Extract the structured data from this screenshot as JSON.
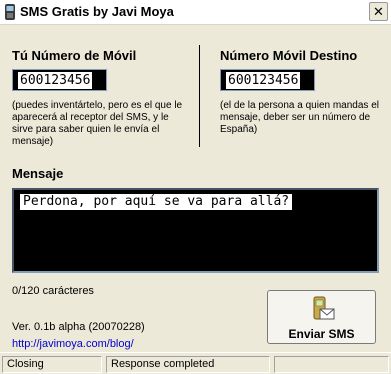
{
  "window": {
    "title": "SMS Gratis by Javi Moya",
    "close_symbol": "✕"
  },
  "sender": {
    "label": "Tú Número de Móvil",
    "value": "600123456",
    "note": "(puedes inventártelo, pero es el que le aparecerá al receptor del SMS, y le sirve para saber quien le envía el mensaje)"
  },
  "recipient": {
    "label": "Número Móvil Destino",
    "value": "600123456",
    "note": "(el de la persona a quien mandas el mensaje, deber ser un número de España)"
  },
  "message": {
    "label": "Mensaje",
    "value": "Perdona, por aquí se va para allá?",
    "counter": "0/120 carácteres"
  },
  "footer": {
    "version": "Ver. 0.1b alpha (20070228)",
    "link": "http://javimoya.com/blog/"
  },
  "send_button": {
    "label": "Enviar SMS",
    "icon": "phone-envelope-icon"
  },
  "statusbar": {
    "panel1": "Closing",
    "panel2": "Response completed",
    "panel3": ""
  }
}
